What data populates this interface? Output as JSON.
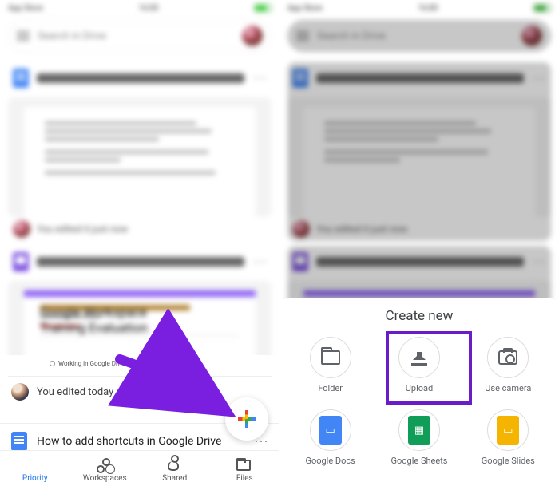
{
  "status": {
    "left_text": "App Store",
    "time": "16:00"
  },
  "search": {
    "placeholder": "Search in Drive"
  },
  "files": {
    "doc_title": "How to upload files...roid to Google Drive",
    "form_title": "G Suite Tips Training Feedback Form",
    "form_body_heading": "Google Workspace Training Evaluation",
    "edited_now": "You edited it just now",
    "form_sub_caption": "Working in Google Drive",
    "edited_today": "You edited today",
    "file_row_title": "How to add shortcuts in Google Drive"
  },
  "nav": {
    "priority": "Priority",
    "workspaces": "Workspaces",
    "shared": "Shared",
    "files": "Files"
  },
  "sheet": {
    "heading": "Create new",
    "options": {
      "folder": "Folder",
      "upload": "Upload",
      "camera": "Use camera",
      "docs": "Google Docs",
      "sheets": "Google Sheets",
      "slides": "Google Slides"
    }
  }
}
